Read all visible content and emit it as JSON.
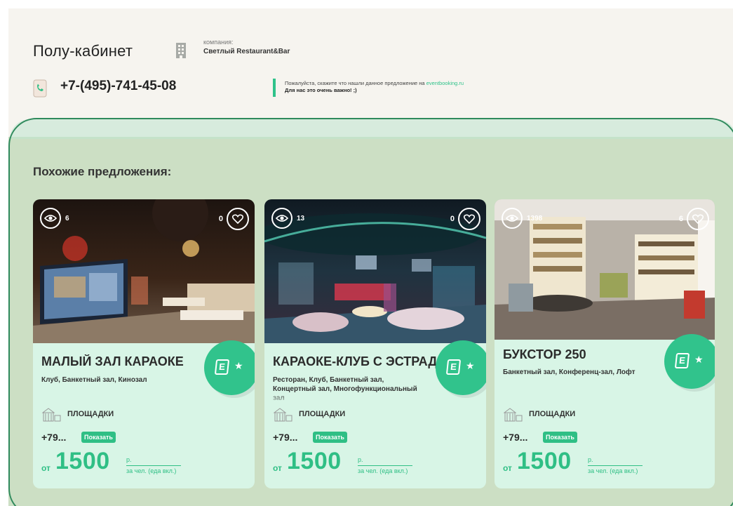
{
  "header": {
    "title": "Полу-кабинет",
    "company_label": "компания:",
    "company_name": "Светлый Restaurant&Bar",
    "phone": "+7-(495)-741-45-08",
    "notice_text": "Пожалуйста, скажите что нашли данное предложение на",
    "notice_link": "eventbooking.ru",
    "notice_emphasis": "Для нас это очень важно! ;)"
  },
  "similar": {
    "title": "Похожие предложения:",
    "cards": [
      {
        "name": "МАЛЫЙ ЗАЛ КАРАОКЕ",
        "types": "Клуб, Банкетный зал, Кинозал",
        "views": "6",
        "likes": "0",
        "venues_label": "ПЛОЩАДКИ",
        "phone": "+79...",
        "show_label": "Показать",
        "price_from": "от",
        "price": "1500",
        "price_unit": "р.",
        "price_desc": "за чел. (еда вкл.)"
      },
      {
        "name": "КАРАОКЕ-КЛУБ С ЭСТРАДОЙ",
        "types": "Ресторан, Клуб, Банкетный зал, Концертный зал, Многофункциональный зал",
        "views": "13",
        "likes": "0",
        "venues_label": "ПЛОЩАДКИ",
        "phone": "+79...",
        "show_label": "Показать",
        "price_from": "от",
        "price": "1500",
        "price_unit": "р.",
        "price_desc": "за чел. (еда вкл.)"
      },
      {
        "name": "БУКСТОР 250",
        "types": "Банкетный зал, Конференц-зал, Лофт",
        "views": "1398",
        "likes": "6",
        "venues_label": "ПЛОЩАДКИ",
        "phone": "+79...",
        "show_label": "Показать",
        "price_from": "от",
        "price": "1500",
        "price_unit": "р.",
        "price_desc": "за чел. (еда вкл.)"
      }
    ]
  },
  "colors": {
    "accent": "#2fbf85",
    "highlight_border": "#2f8a5c",
    "card_background": "#d8f5e6",
    "section_background": "#ccdfc4"
  },
  "icons": [
    "building-icon",
    "phone-icon",
    "eye-icon",
    "heart-icon",
    "eventbooking-logo-icon",
    "star-icon",
    "venues-icon"
  ]
}
